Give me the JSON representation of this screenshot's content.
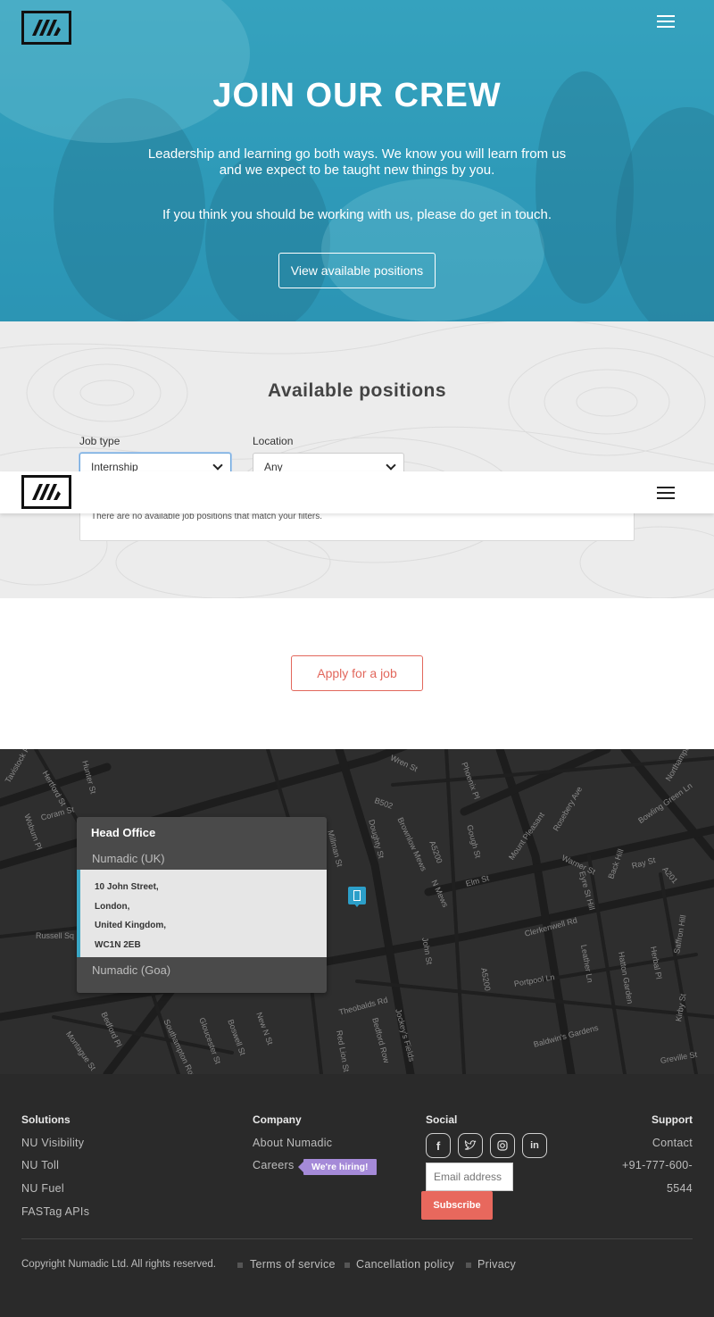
{
  "hero": {
    "title": "JOIN OUR CREW",
    "para1_line1": "Leadership and learning go both ways. We know you will learn from us",
    "para1_line2": "and we expect to be taught new things by you.",
    "para2": "If you think you should be working with us, please do get in touch.",
    "cta": "View available positions"
  },
  "positions": {
    "title": "Available positions",
    "job_type_label": "Job type",
    "job_type_value": "Internship",
    "location_label": "Location",
    "location_value": "Any",
    "empty_message": "There are no available job positions that match your filters."
  },
  "apply": {
    "label": "Apply for a job"
  },
  "map": {
    "card_heading": "Head Office",
    "offices": [
      {
        "name": "Numadic (UK)",
        "address": [
          "10 John Street,",
          "London,",
          "United Kingdom,",
          "WC1N 2EB"
        ]
      },
      {
        "name": "Numadic (Goa)"
      }
    ],
    "streets": [
      "Tavistock Pl",
      "Hertford St",
      "Hunter St",
      "Coram St",
      "Woburn Pl",
      "Russell Sq",
      "Millman St",
      "Doughty St",
      "B502",
      "Brownlow Mews",
      "A5200",
      "Gough St",
      "Wren St",
      "Phoenix Pl",
      "Mount Pleasant",
      "Rosebery Ave",
      "Bowling Green Ln",
      "Warner St",
      "Ray St",
      "A201",
      "Eyre St Hill",
      "Back Hill",
      "Elm St",
      "N Mews",
      "John St",
      "A5200",
      "Clerkenwell Rd",
      "Leather Ln",
      "Hatton Garden",
      "Saffron Hill",
      "Kirby St",
      "Herbal Pl",
      "Portpool Ln",
      "Baldwin's Gardens",
      "Theobalds Rd",
      "Bedford Row",
      "Jockey's Fields",
      "Red Lion St",
      "New N St",
      "Boswell St",
      "Gloucester St",
      "Southampton Row",
      "Bedford Pl",
      "Montague St",
      "Greville St",
      "Northampton Rd"
    ]
  },
  "footer": {
    "solutions": {
      "heading": "Solutions",
      "links": [
        "NU Visibility",
        "NU Toll",
        "NU Fuel",
        "FASTag APIs"
      ]
    },
    "company": {
      "heading": "Company",
      "links": [
        "About Numadic",
        "Careers"
      ],
      "badge": "We're hiring!"
    },
    "social": {
      "heading": "Social",
      "icons": [
        "facebook-icon",
        "twitter-icon",
        "instagram-icon",
        "linkedin-icon"
      ],
      "email_placeholder": "Email address",
      "subscribe": "Subscribe"
    },
    "support": {
      "heading": "Support",
      "contact": "Contact",
      "phone_line1": "+91-777-600-",
      "phone_line2": "5544"
    },
    "copyright": "Copyright Numadic Ltd. All rights reserved.",
    "legal": [
      "Terms of service",
      "Cancellation policy",
      "Privacy"
    ]
  },
  "colors": {
    "accent_teal": "#2f97b6",
    "accent_coral": "#e2675c",
    "badge_purple": "#a58ad8",
    "footer_bg": "#2a2a2a",
    "map_bg": "#2e2e2e"
  }
}
